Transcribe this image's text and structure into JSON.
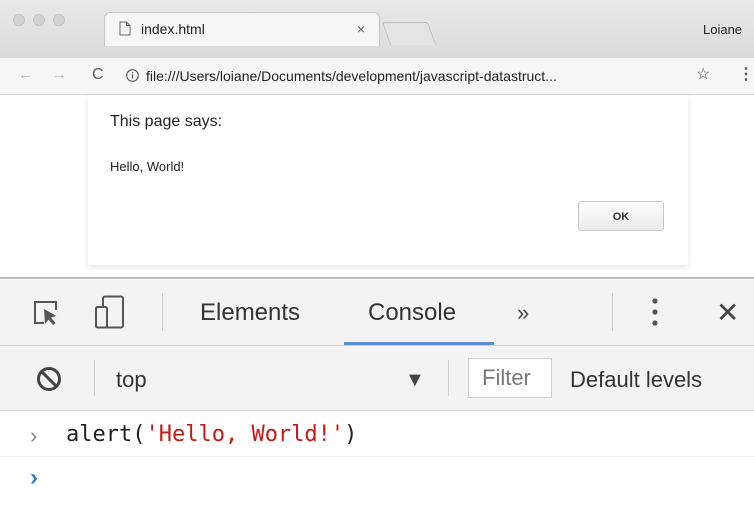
{
  "browser": {
    "tab_title": "index.html",
    "tab_close": "×",
    "profile_name": "Loiane",
    "nav_back": "←",
    "nav_forward": "→",
    "reload": "C",
    "url": "file:///Users/loiane/Documents/development/javascript-datastruct...",
    "star": "☆",
    "menu": "⋮"
  },
  "dialog": {
    "title": "This page says:",
    "message": "Hello, World!",
    "ok_label": "OK"
  },
  "devtools": {
    "tabs": [
      "Elements",
      "Console"
    ],
    "active_tab": "Console",
    "more_tabs": "»",
    "close": "✕",
    "context": "top",
    "context_arrow": "▼",
    "filter_placeholder": "Filter",
    "levels": "Default levels",
    "console_input": {
      "prompt": "›",
      "code_prefix": "alert(",
      "code_string": "'Hello, World!'",
      "code_suffix": ")"
    },
    "active_prompt": "›"
  },
  "colors": {
    "accent": "#5d8ccf",
    "string": "#c41a16",
    "prompt_blue": "#3e7bd6"
  }
}
